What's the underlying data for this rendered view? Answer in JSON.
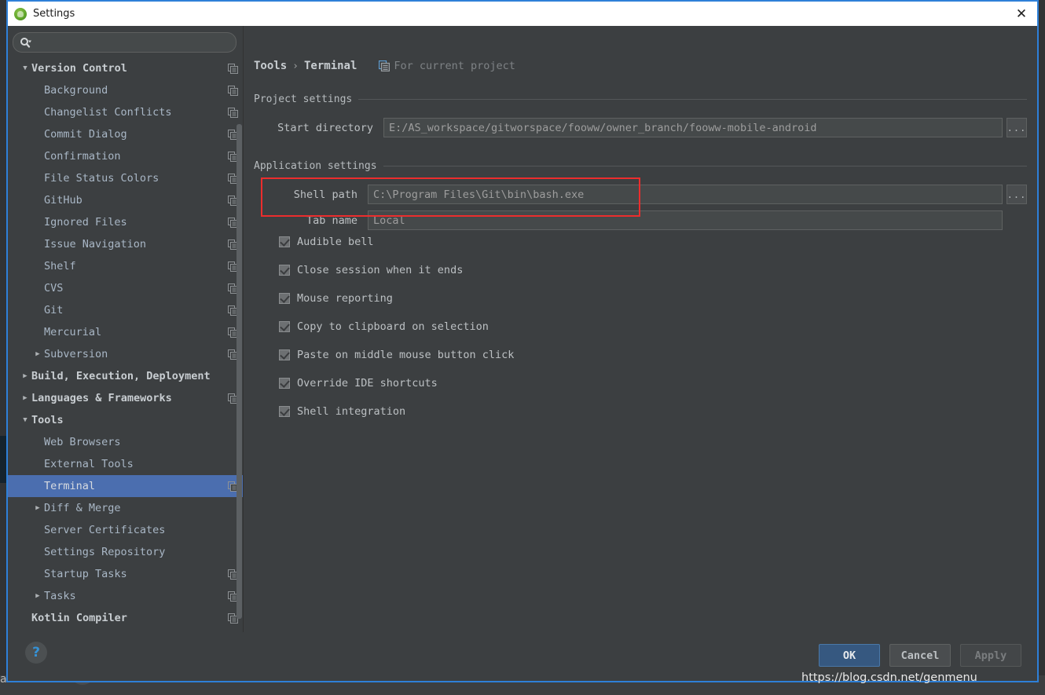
{
  "window": {
    "title": "Settings",
    "app_icon": "android-studio-icon",
    "close_icon": "close-icon"
  },
  "search": {
    "placeholder": "",
    "value": "",
    "icon": "search-icon",
    "dropdown_icon": "chevron-down-icon"
  },
  "sidebar": {
    "items": [
      {
        "label": "Version Control",
        "level": 0,
        "bold": true,
        "arrow": "down",
        "copy": true,
        "selected": false
      },
      {
        "label": "Background",
        "level": 1,
        "bold": false,
        "arrow": "none",
        "copy": true,
        "selected": false
      },
      {
        "label": "Changelist Conflicts",
        "level": 1,
        "bold": false,
        "arrow": "none",
        "copy": true,
        "selected": false
      },
      {
        "label": "Commit Dialog",
        "level": 1,
        "bold": false,
        "arrow": "none",
        "copy": true,
        "selected": false
      },
      {
        "label": "Confirmation",
        "level": 1,
        "bold": false,
        "arrow": "none",
        "copy": true,
        "selected": false
      },
      {
        "label": "File Status Colors",
        "level": 1,
        "bold": false,
        "arrow": "none",
        "copy": true,
        "selected": false
      },
      {
        "label": "GitHub",
        "level": 1,
        "bold": false,
        "arrow": "none",
        "copy": true,
        "selected": false
      },
      {
        "label": "Ignored Files",
        "level": 1,
        "bold": false,
        "arrow": "none",
        "copy": true,
        "selected": false
      },
      {
        "label": "Issue Navigation",
        "level": 1,
        "bold": false,
        "arrow": "none",
        "copy": true,
        "selected": false
      },
      {
        "label": "Shelf",
        "level": 1,
        "bold": false,
        "arrow": "none",
        "copy": true,
        "selected": false
      },
      {
        "label": "CVS",
        "level": 1,
        "bold": false,
        "arrow": "none",
        "copy": true,
        "selected": false
      },
      {
        "label": "Git",
        "level": 1,
        "bold": false,
        "arrow": "none",
        "copy": true,
        "selected": false
      },
      {
        "label": "Mercurial",
        "level": 1,
        "bold": false,
        "arrow": "none",
        "copy": true,
        "selected": false
      },
      {
        "label": "Subversion",
        "level": 1,
        "bold": false,
        "arrow": "right",
        "copy": true,
        "selected": false
      },
      {
        "label": "Build, Execution, Deployment",
        "level": 0,
        "bold": true,
        "arrow": "right",
        "copy": false,
        "selected": false
      },
      {
        "label": "Languages & Frameworks",
        "level": 0,
        "bold": true,
        "arrow": "right",
        "copy": true,
        "selected": false
      },
      {
        "label": "Tools",
        "level": 0,
        "bold": true,
        "arrow": "down",
        "copy": false,
        "selected": false
      },
      {
        "label": "Web Browsers",
        "level": 1,
        "bold": false,
        "arrow": "none",
        "copy": false,
        "selected": false
      },
      {
        "label": "External Tools",
        "level": 1,
        "bold": false,
        "arrow": "none",
        "copy": false,
        "selected": false
      },
      {
        "label": "Terminal",
        "level": 1,
        "bold": false,
        "arrow": "none",
        "copy": true,
        "selected": true
      },
      {
        "label": "Diff & Merge",
        "level": 1,
        "bold": false,
        "arrow": "right",
        "copy": false,
        "selected": false
      },
      {
        "label": "Server Certificates",
        "level": 1,
        "bold": false,
        "arrow": "none",
        "copy": false,
        "selected": false
      },
      {
        "label": "Settings Repository",
        "level": 1,
        "bold": false,
        "arrow": "none",
        "copy": false,
        "selected": false
      },
      {
        "label": "Startup Tasks",
        "level": 1,
        "bold": false,
        "arrow": "none",
        "copy": true,
        "selected": false
      },
      {
        "label": "Tasks",
        "level": 1,
        "bold": false,
        "arrow": "right",
        "copy": true,
        "selected": false
      },
      {
        "label": "Kotlin Compiler",
        "level": 0,
        "bold": true,
        "arrow": "none",
        "copy": true,
        "selected": false
      }
    ]
  },
  "breadcrumb": {
    "root": "Tools",
    "separator": "›",
    "leaf": "Terminal",
    "project_icon": "copy-pages-icon",
    "project_scope": "For current project"
  },
  "project_settings": {
    "section_title": "Project settings",
    "start_directory": {
      "label": "Start directory",
      "value": "E:/AS_workspace/gitworspace/fooww/owner_branch/fooww-mobile-android",
      "browse_label": "..."
    }
  },
  "application_settings": {
    "section_title": "Application settings",
    "shell_path": {
      "label": "Shell path",
      "value": "C:\\Program Files\\Git\\bin\\bash.exe",
      "browse_label": "..."
    },
    "tab_name": {
      "label": "Tab name",
      "value": "Local"
    },
    "checkboxes": [
      {
        "label": "Audible bell",
        "checked": true
      },
      {
        "label": "Close session when it ends",
        "checked": true
      },
      {
        "label": "Mouse reporting",
        "checked": true
      },
      {
        "label": "Copy to clipboard on selection",
        "checked": true
      },
      {
        "label": "Paste on middle mouse button click",
        "checked": true
      },
      {
        "label": "Override IDE shortcuts",
        "checked": true
      },
      {
        "label": "Shell integration",
        "checked": true
      }
    ]
  },
  "footer": {
    "help_label": "?",
    "ok_label": "OK",
    "cancel_label": "Cancel",
    "apply_label": "Apply"
  },
  "annotation": {
    "highlight_color": "#ec2d2d"
  },
  "overlay": {
    "watermark": "https://blog.csdn.net/genmenu"
  },
  "background": {
    "left_text": "a",
    "faded_text": "·   ·   ·   ·"
  },
  "colors": {
    "window_border": "#2e80d8",
    "panel_bg": "#3c3f41",
    "selection": "#4b6eaf",
    "text": "#bcc0c3",
    "muted_text": "#7e8285",
    "accent_ok": "#365880"
  }
}
